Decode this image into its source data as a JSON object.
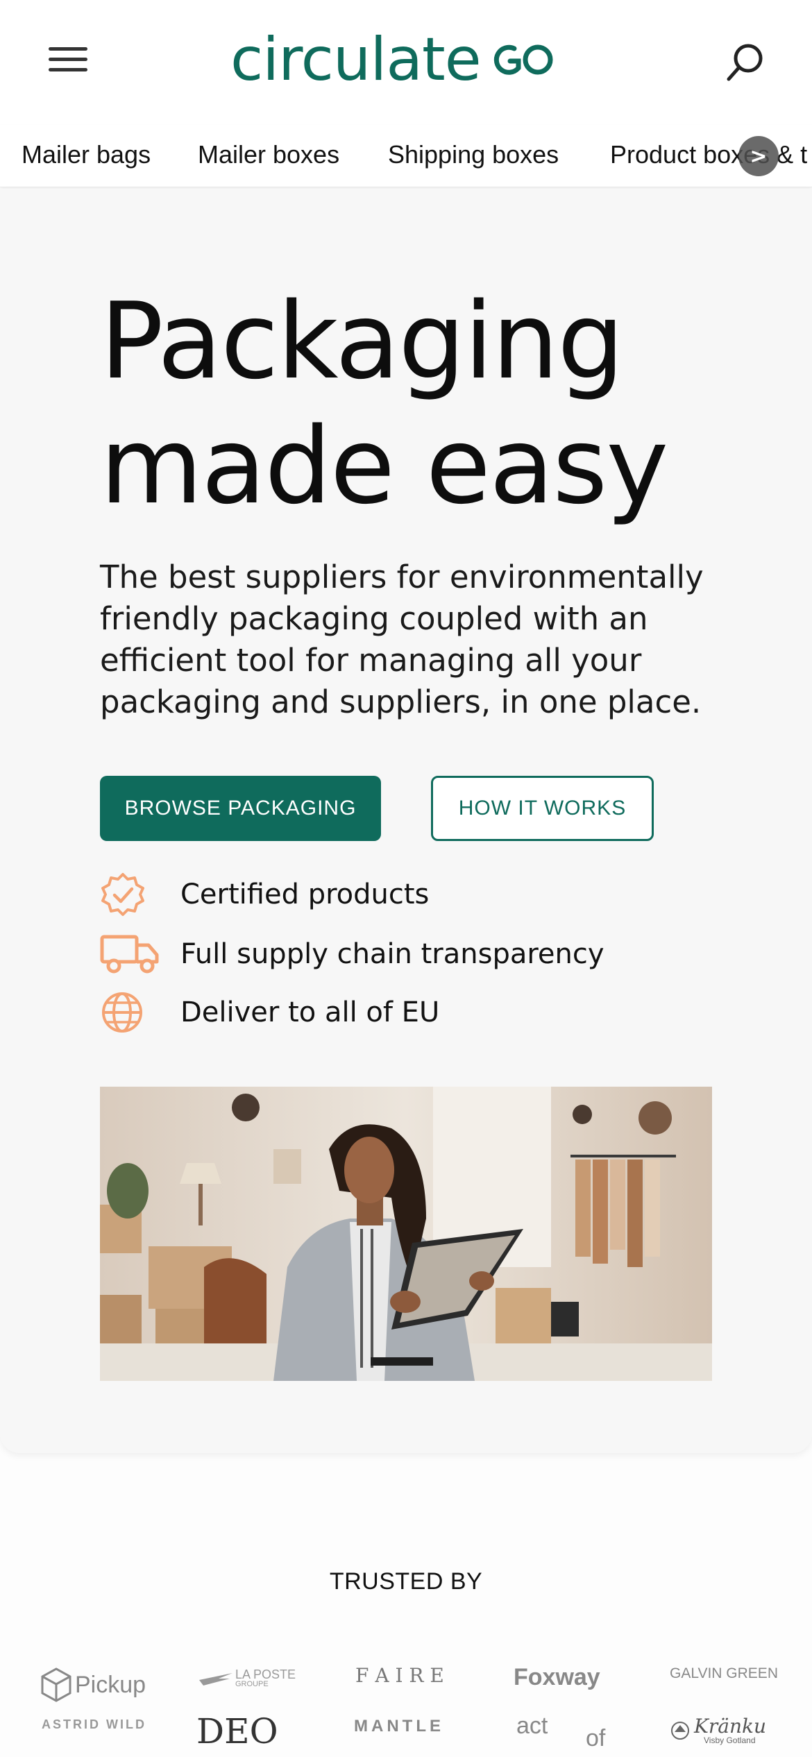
{
  "header": {
    "logo_text": "circulate",
    "colors": {
      "brand": "#0f6b5c",
      "accent": "#f4a373"
    },
    "menu_icon": "hamburger-menu-icon",
    "search_icon": "search-icon"
  },
  "nav": {
    "items": [
      {
        "label": "Mailer bags"
      },
      {
        "label": "Mailer boxes"
      },
      {
        "label": "Shipping boxes"
      },
      {
        "label": "Product boxes & t"
      }
    ],
    "scroll_glyph": ">"
  },
  "hero": {
    "title_line1": "Packaging",
    "title_line2": "made easy",
    "subtitle": "The best suppliers for environmentally friendly packaging coupled with an efficient tool for managing all your packaging and suppliers, in one place.",
    "primary_button": "BROWSE PACKAGING",
    "secondary_button": "HOW IT WORKS",
    "features": [
      {
        "icon": "certified-badge-icon",
        "label": "Certified products"
      },
      {
        "icon": "truck-icon",
        "label": "Full supply chain transparency"
      },
      {
        "icon": "globe-icon",
        "label": "Deliver to all of EU"
      }
    ]
  },
  "trusted": {
    "title": "TRUSTED BY",
    "brands_row1": [
      "Pickup",
      "LA POSTE",
      "GROUPE",
      "F A I R E",
      "Foxway",
      "GALVIN GREEN"
    ],
    "brands_row2": [
      "ASTRID WILD",
      "DEO",
      "MANTLE",
      "act",
      "of",
      "Kränku",
      "Visby Gotland"
    ]
  }
}
